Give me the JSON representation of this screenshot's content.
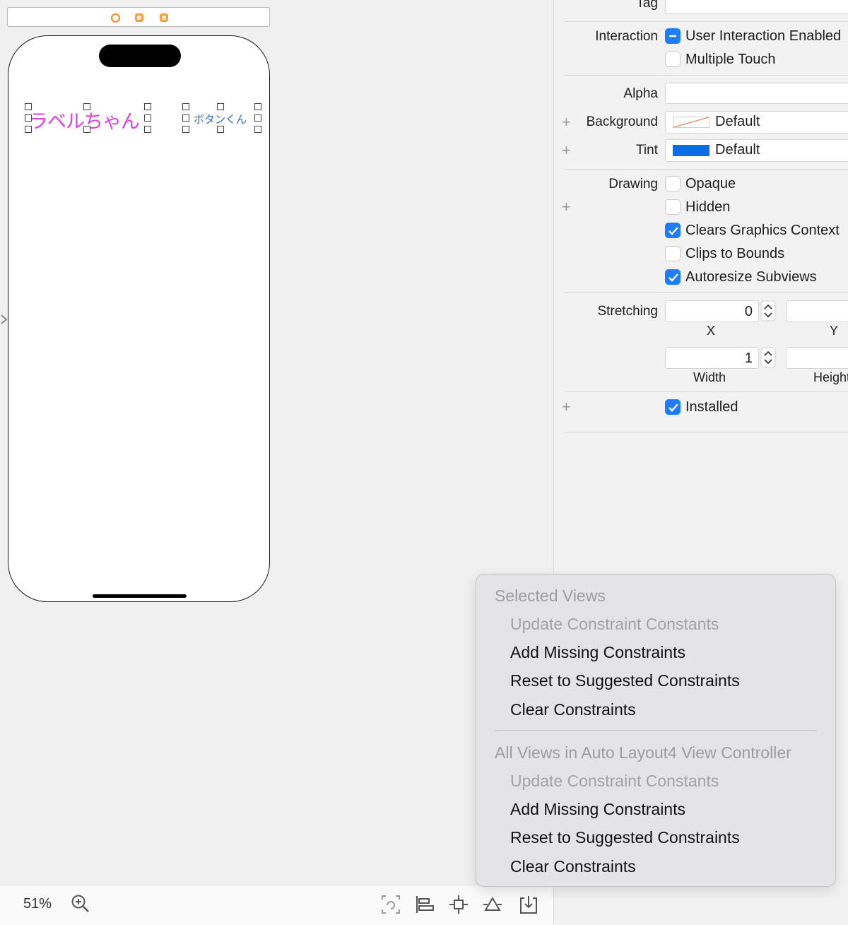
{
  "canvas": {
    "label_text": "ラベルちゃん",
    "button_text": "ボタンくん",
    "label_color": "#e03fe0",
    "button_color": "#2b6fc4",
    "scene_dock_icons": [
      "view-controller-icon",
      "first-responder-icon",
      "exit-icon"
    ]
  },
  "toolbar": {
    "zoom_level": "51%",
    "icons": [
      "zoom-in-icon",
      "update-frames-icon",
      "align-icon",
      "add-constraints-icon",
      "resolve-auto-layout-icon",
      "embed-in-icon"
    ]
  },
  "inspector": {
    "tag_label": "Tag",
    "interaction_label": "Interaction",
    "user_interaction_enabled": "User Interaction Enabled",
    "multiple_touch": "Multiple Touch",
    "alpha_label": "Alpha",
    "background_label": "Background",
    "background_value": "Default",
    "tint_label": "Tint",
    "tint_value": "Default",
    "tint_color": "#0a6ee6",
    "drawing_label": "Drawing",
    "opaque": "Opaque",
    "hidden": "Hidden",
    "clears_graphics_context": "Clears Graphics Context",
    "clips_to_bounds": "Clips to Bounds",
    "autoresize_subviews": "Autoresize Subviews",
    "stretching_label": "Stretching",
    "stretch_x_value": "0",
    "stretch_x_label": "X",
    "stretch_y_label": "Y",
    "stretch_width_value": "1",
    "stretch_width_label": "Width",
    "stretch_height_label": "Height",
    "installed": "Installed",
    "checkbox_states": {
      "user_interaction_enabled": "mixed",
      "multiple_touch": false,
      "opaque": false,
      "hidden": false,
      "clears_graphics_context": true,
      "clips_to_bounds": false,
      "autoresize_subviews": true,
      "installed": true
    }
  },
  "resolve_menu": {
    "section1_header": "Selected Views",
    "section1_items": [
      {
        "label": "Update Constraint Constants",
        "enabled": false
      },
      {
        "label": "Add Missing Constraints",
        "enabled": true
      },
      {
        "label": "Reset to Suggested Constraints",
        "enabled": true
      },
      {
        "label": "Clear Constraints",
        "enabled": true
      }
    ],
    "section2_header": "All Views in Auto Layout4 View Controller",
    "section2_items": [
      {
        "label": "Update Constraint Constants",
        "enabled": false
      },
      {
        "label": "Add Missing Constraints",
        "enabled": true
      },
      {
        "label": "Reset to Suggested Constraints",
        "enabled": true
      },
      {
        "label": "Clear Constraints",
        "enabled": true
      }
    ]
  }
}
